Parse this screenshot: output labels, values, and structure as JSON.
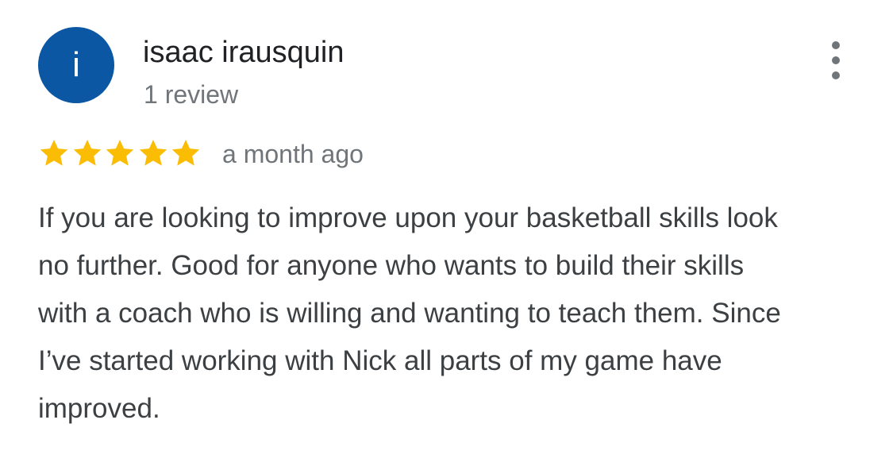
{
  "review": {
    "author": {
      "initial": "i",
      "name": "isaac irausquin",
      "review_count": "1 review",
      "avatar_color": "#0b57a4"
    },
    "more_options_icon": "more-vertical-icon",
    "rating": {
      "stars": 5,
      "max": 5,
      "star_color": "#fbbc04"
    },
    "time": "a month ago",
    "text": "If you are looking to improve upon your basketball skills look no further. Good for anyone who wants to build their skills with a coach who is willing and wanting to teach them. Since I’ve started working with Nick all parts of my game have improved."
  }
}
